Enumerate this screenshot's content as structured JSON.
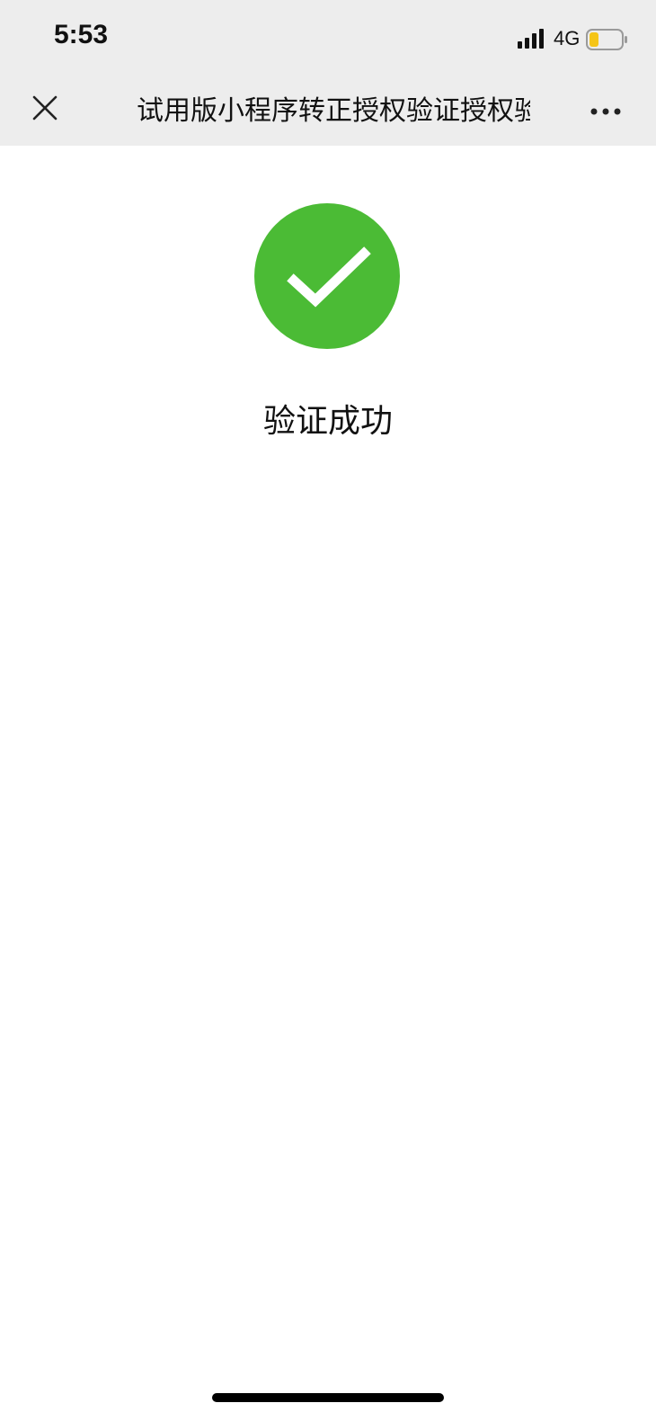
{
  "status_bar": {
    "time": "5:53",
    "network": "4G",
    "icons": [
      "signal-icon",
      "battery-icon"
    ]
  },
  "nav": {
    "title": "试用版小程序转正授权验证授权验证授权",
    "icons": [
      "close-icon",
      "more-icon"
    ]
  },
  "result": {
    "message": "验证成功",
    "icon": "check-circle-icon",
    "accent_color": "#4bbb35"
  },
  "colors": {
    "bar_background": "#ededed",
    "page_background": "#ffffff",
    "battery_level": "#f5c518"
  }
}
